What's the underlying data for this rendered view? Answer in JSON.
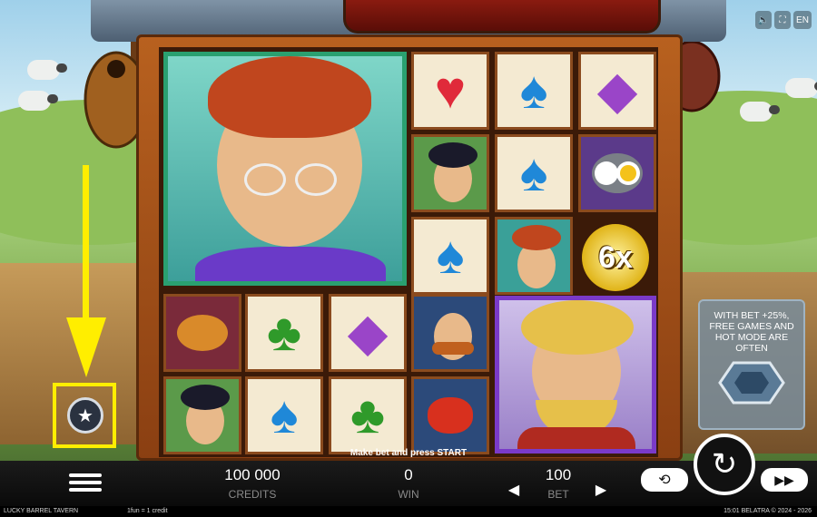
{
  "game": {
    "title": "LUCKY BARREL TAVERN"
  },
  "top_controls": {
    "sound_icon": "speaker-icon",
    "fullscreen_icon": "fullscreen-icon",
    "language": "EN"
  },
  "reels": {
    "big_symbols": [
      "old-elf-with-glasses",
      "blonde-elf-with-pipe"
    ],
    "symbols": [
      "heart",
      "spade",
      "diamond",
      "elf-black-hair",
      "spade",
      "fried-eggs",
      "spade",
      "elf-red-hair",
      "roast-chicken",
      "club",
      "diamond",
      "elf-ginger",
      "elf-black-hair",
      "spade",
      "club",
      "lobster"
    ],
    "multiplier": "6x",
    "glyphs": {
      "heart": "♥",
      "spade": "♠",
      "club": "♣",
      "diamond": "◆"
    }
  },
  "promo": {
    "text": "WITH BET +25%, FREE GAMES AND HOT MODE ARE OFTEN"
  },
  "status_message": "Make bet and press START",
  "bottom": {
    "credits_value": "100 000",
    "credits_label": "CREDITS",
    "win_value": "0",
    "win_label": "WIN",
    "bet_value": "100",
    "bet_label": "BET",
    "bet_prev": "◀",
    "bet_next": "▶"
  },
  "footer": {
    "left": "LUCKY BARREL TAVERN",
    "center": "1fun = 1 credit",
    "right": "15:01  BELATRA © 2024 - 2026"
  },
  "colors": {
    "highlight": "#ffee00",
    "frame": "#b8611f"
  }
}
